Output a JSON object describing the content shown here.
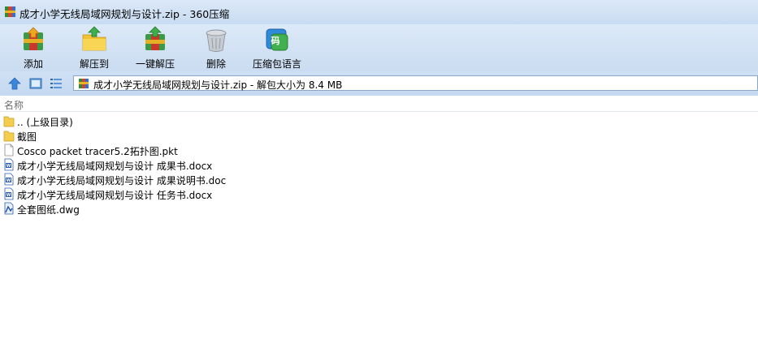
{
  "window": {
    "title": "成才小学无线局域网规划与设计.zip - 360压缩"
  },
  "toolbar": {
    "buttons": [
      {
        "id": "add",
        "label": "添加",
        "icon": "add-archive-icon"
      },
      {
        "id": "extract-to",
        "label": "解压到",
        "icon": "extract-folder-icon"
      },
      {
        "id": "one-click-extract",
        "label": "一键解压",
        "icon": "quick-extract-icon"
      },
      {
        "id": "delete",
        "label": "删除",
        "icon": "trash-icon"
      },
      {
        "id": "language",
        "label": "压缩包语言",
        "icon": "codepage-icon",
        "badge": "码"
      }
    ]
  },
  "addressbar": {
    "path": "成才小学无线局域网规划与设计.zip - 解包大小为 8.4 MB"
  },
  "filelist": {
    "column_name": "名称",
    "items": [
      {
        "name": ".. (上级目录)",
        "type": "folder"
      },
      {
        "name": "截图",
        "type": "folder"
      },
      {
        "name": "Cosco packet tracer5.2拓扑图.pkt",
        "type": "file"
      },
      {
        "name": "成才小学无线局域网规划与设计 成果书.docx",
        "type": "word"
      },
      {
        "name": "成才小学无线局域网规划与设计 成果说明书.doc",
        "type": "word"
      },
      {
        "name": "成才小学无线局域网规划与设计 任务书.docx",
        "type": "word"
      },
      {
        "name": "全套图纸.dwg",
        "type": "dwg"
      }
    ]
  },
  "colors": {
    "titlebar": "#d4e4f6",
    "toolbar": "#d2e2f5",
    "accent": "#2a6fd0"
  }
}
